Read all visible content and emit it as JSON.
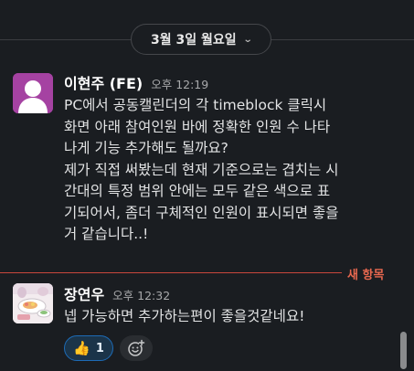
{
  "date_divider": {
    "label": "3월 3일 월요일",
    "chevron_icon": "chevron-down-icon"
  },
  "messages": [
    {
      "author": "이현주 (FE)",
      "time": "오후 12:19",
      "avatar_icon": "default-user-avatar",
      "avatar_color": "#a542a2",
      "lines": [
        "PC에서 공동캘린더의  각 timeblock 클릭시",
        "화면 아래 참여인원 바에 정확한 인원 수 나타",
        "나게 기능 추가해도 될까요?",
        "제가 직접 써봤는데 현재 기준으로는 겹치는 시",
        "간대의 특정  범위 안에는 모두 같은 색으로 표",
        "기되어서, 좀더 구체적인 인원이 표시되면 좋을",
        "거 같습니다..!"
      ]
    },
    {
      "author": "장연우",
      "time": "오후 12:32",
      "avatar_icon": "food-illustration-avatar",
      "lines": [
        "넵 가능하면 추가하는편이 좋을것같네요!"
      ],
      "reactions": [
        {
          "emoji": "👍",
          "count": "1"
        }
      ]
    }
  ],
  "new_items_label": "새 항목",
  "add_reaction_icon": "add-emoji-icon",
  "colors": {
    "background": "#1a1d21",
    "new_divider": "#c9473c",
    "reaction_border": "#1d6bb6"
  }
}
